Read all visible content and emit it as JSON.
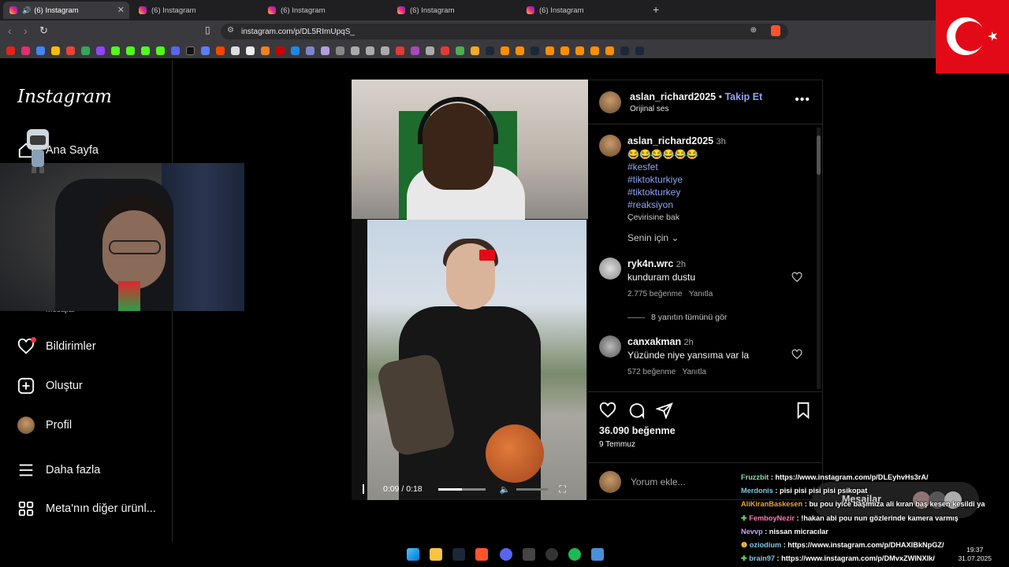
{
  "browser": {
    "tabs": [
      {
        "label": "(6) Instagram",
        "active": true,
        "audio": true
      },
      {
        "label": "(6) Instagram"
      },
      {
        "label": "(6) Instagram"
      },
      {
        "label": "(6) Instagram"
      },
      {
        "label": "(6) Instagram"
      }
    ],
    "url": "instagram.com/p/DL5RImUpqS_"
  },
  "sidebar": {
    "logo": "Instagram",
    "items": [
      {
        "label": "Ana Sayfa",
        "icon": "home-icon"
      },
      {
        "label": "Bildirimler",
        "icon": "heart-icon"
      },
      {
        "label": "Oluştur",
        "icon": "plus-square-icon"
      },
      {
        "label": "Profil",
        "icon": "avatar"
      },
      {
        "label": "Daha fazla",
        "icon": "menu-icon"
      },
      {
        "label": "Meta'nın diğer ürünl...",
        "icon": "grid-icon"
      }
    ],
    "partial_item": "Mesajlar"
  },
  "post": {
    "author": "aslan_richard2025",
    "follow_label": "Takip Et",
    "audio": "Orijinal ses",
    "caption": {
      "author": "aslan_richard2025",
      "time": "3h",
      "emoji": "😂😂😂😂😂😂",
      "hashtags": [
        "#kesfet",
        "#tiktokturkiye",
        "#tiktokturkey",
        "#reaksiyon"
      ],
      "translate": "Çevirisine bak"
    },
    "sort_label": "Senin için",
    "comments": [
      {
        "user": "ryk4n.wrc",
        "time": "2h",
        "text": "kunduram dustu",
        "likes": "2.775 beğenme",
        "reply": "Yanıtla",
        "view_replies": "8 yanıtın tümünü gör"
      },
      {
        "user": "canxakman",
        "time": "2h",
        "text": "Yüzünde niye yansıma var la",
        "likes": "572 beğenme",
        "reply": "Yanıtla"
      }
    ],
    "like_count": "36.090 beğenme",
    "date": "9 Temmuz",
    "comment_placeholder": "Yorum ekle...",
    "video": {
      "time": "0:09 / 0:18",
      "progress": 0.5
    }
  },
  "overlay": {
    "messages_label": "Mesajlar",
    "chat": [
      {
        "user": "Fruzzbit",
        "color": "#8fd3a8",
        "text": ": https://www.instagram.com/p/DLEyhvHs3rA/"
      },
      {
        "user": "Merdonis",
        "color": "#7ec8e3",
        "text": ": pisi pisi pisi pisi psikopat"
      },
      {
        "user": "AliKiranBaskesen",
        "color": "#e8a33d",
        "text": ": bu pou iyice başımıza ali kıran baş kesen kesildi ya"
      },
      {
        "user": "FemboyNezir",
        "color": "#ff7ab8",
        "text": ": !hakan abi pou nun gözlerinde kamera varmış"
      },
      {
        "user": "Nevvp",
        "color": "#c9a0ff",
        "text": ": nissan micracılar"
      },
      {
        "user": "oziodium",
        "color": "#7ec8e3",
        "text": ": https://www.instagram.com/p/DHAXlBkNpGZ/"
      },
      {
        "user": "brain97",
        "color": "#7ec8e3",
        "text": ": https://www.instagram.com/p/DMvxZWINXlk/"
      }
    ]
  },
  "system": {
    "time": "19:37",
    "date": "31.07.2025"
  },
  "colors": {
    "accent_link": "#8ea5f5",
    "flag_red": "#e30a17"
  }
}
